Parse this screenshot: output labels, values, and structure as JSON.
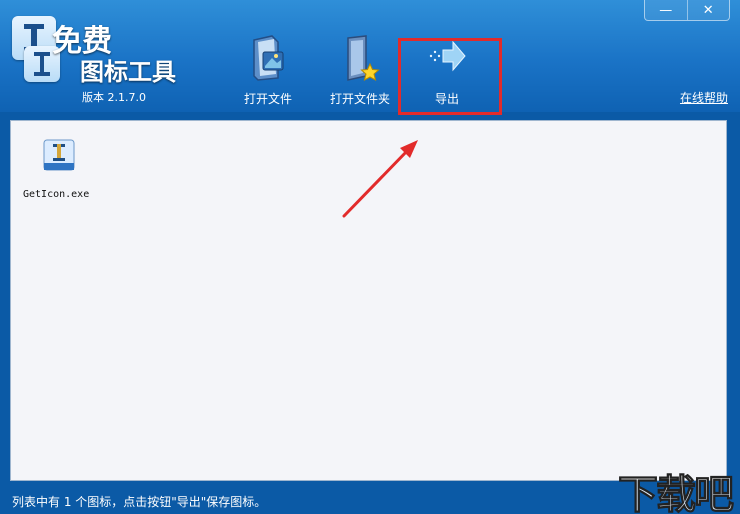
{
  "header": {
    "title_line1": "免费",
    "title_line2": "图标工具",
    "version": "版本 2.1.7.0",
    "help_link": "在线帮助",
    "colors": {
      "header_bg": "#1a73c6",
      "highlight": "#e22b2b",
      "arrow": "#e22b2b"
    }
  },
  "window": {
    "minimize_glyph": "—",
    "close_glyph": "✕"
  },
  "toolbar": {
    "open_file": {
      "label": "打开文件",
      "icon": "open-file-icon"
    },
    "open_folder": {
      "label": "打开文件夹",
      "icon": "open-folder-icon"
    },
    "export": {
      "label": "导出",
      "icon": "export-arrow-icon"
    }
  },
  "file_list": {
    "items": [
      {
        "name": "GetIcon.exe",
        "icon": "app-icon"
      }
    ]
  },
  "statusbar": {
    "text": "列表中有 1 个图标，点击按钮\"导出\"保存图标。",
    "watermark": "下载吧"
  }
}
